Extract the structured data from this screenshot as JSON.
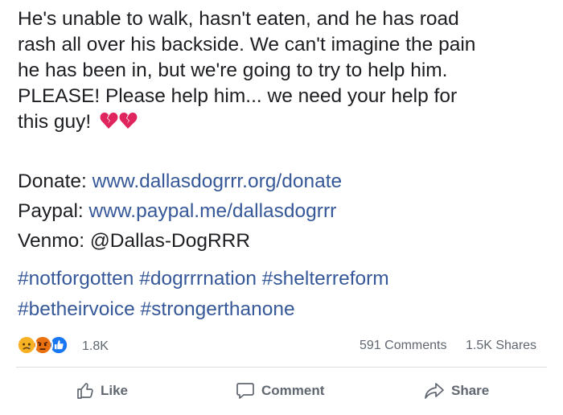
{
  "post": {
    "body_lines": [
      "He's unable to walk, hasn't eaten, and he has road",
      "rash all over his backside. We can't imagine the pain",
      "he has been in, but we're going to try to help him.",
      "PLEASE! Please help him... we need your help for",
      "this guy!"
    ],
    "emoji": "broken-heart-icon"
  },
  "contact": {
    "donate_label": "Donate:",
    "donate_link": "www.dallasdogrrr.org/donate",
    "paypal_label": "Paypal:",
    "paypal_link": "www.paypal.me/dallasdogrrr",
    "venmo_label": "Venmo:",
    "venmo_handle": "@Dallas-DogRRR"
  },
  "hashtags": {
    "line1": [
      "#notforgotten",
      "#dogrrrnation",
      "#shelterreform"
    ],
    "line2": [
      "#betheirvoice",
      "#strongerthanone"
    ]
  },
  "stats": {
    "reactions": [
      "sad-reaction-icon",
      "angry-reaction-icon",
      "like-reaction-icon"
    ],
    "reaction_count": "1.8K",
    "comments": "591 Comments",
    "shares": "1.5K Shares"
  },
  "actions": {
    "like": "Like",
    "comment": "Comment",
    "share": "Share"
  },
  "colors": {
    "link": "#365899",
    "text": "#1c1e21",
    "muted": "#606770",
    "like_blue": "#1877f2",
    "angry": "#e9710f",
    "sad": "#f7b125",
    "heart": "#e0245e"
  }
}
